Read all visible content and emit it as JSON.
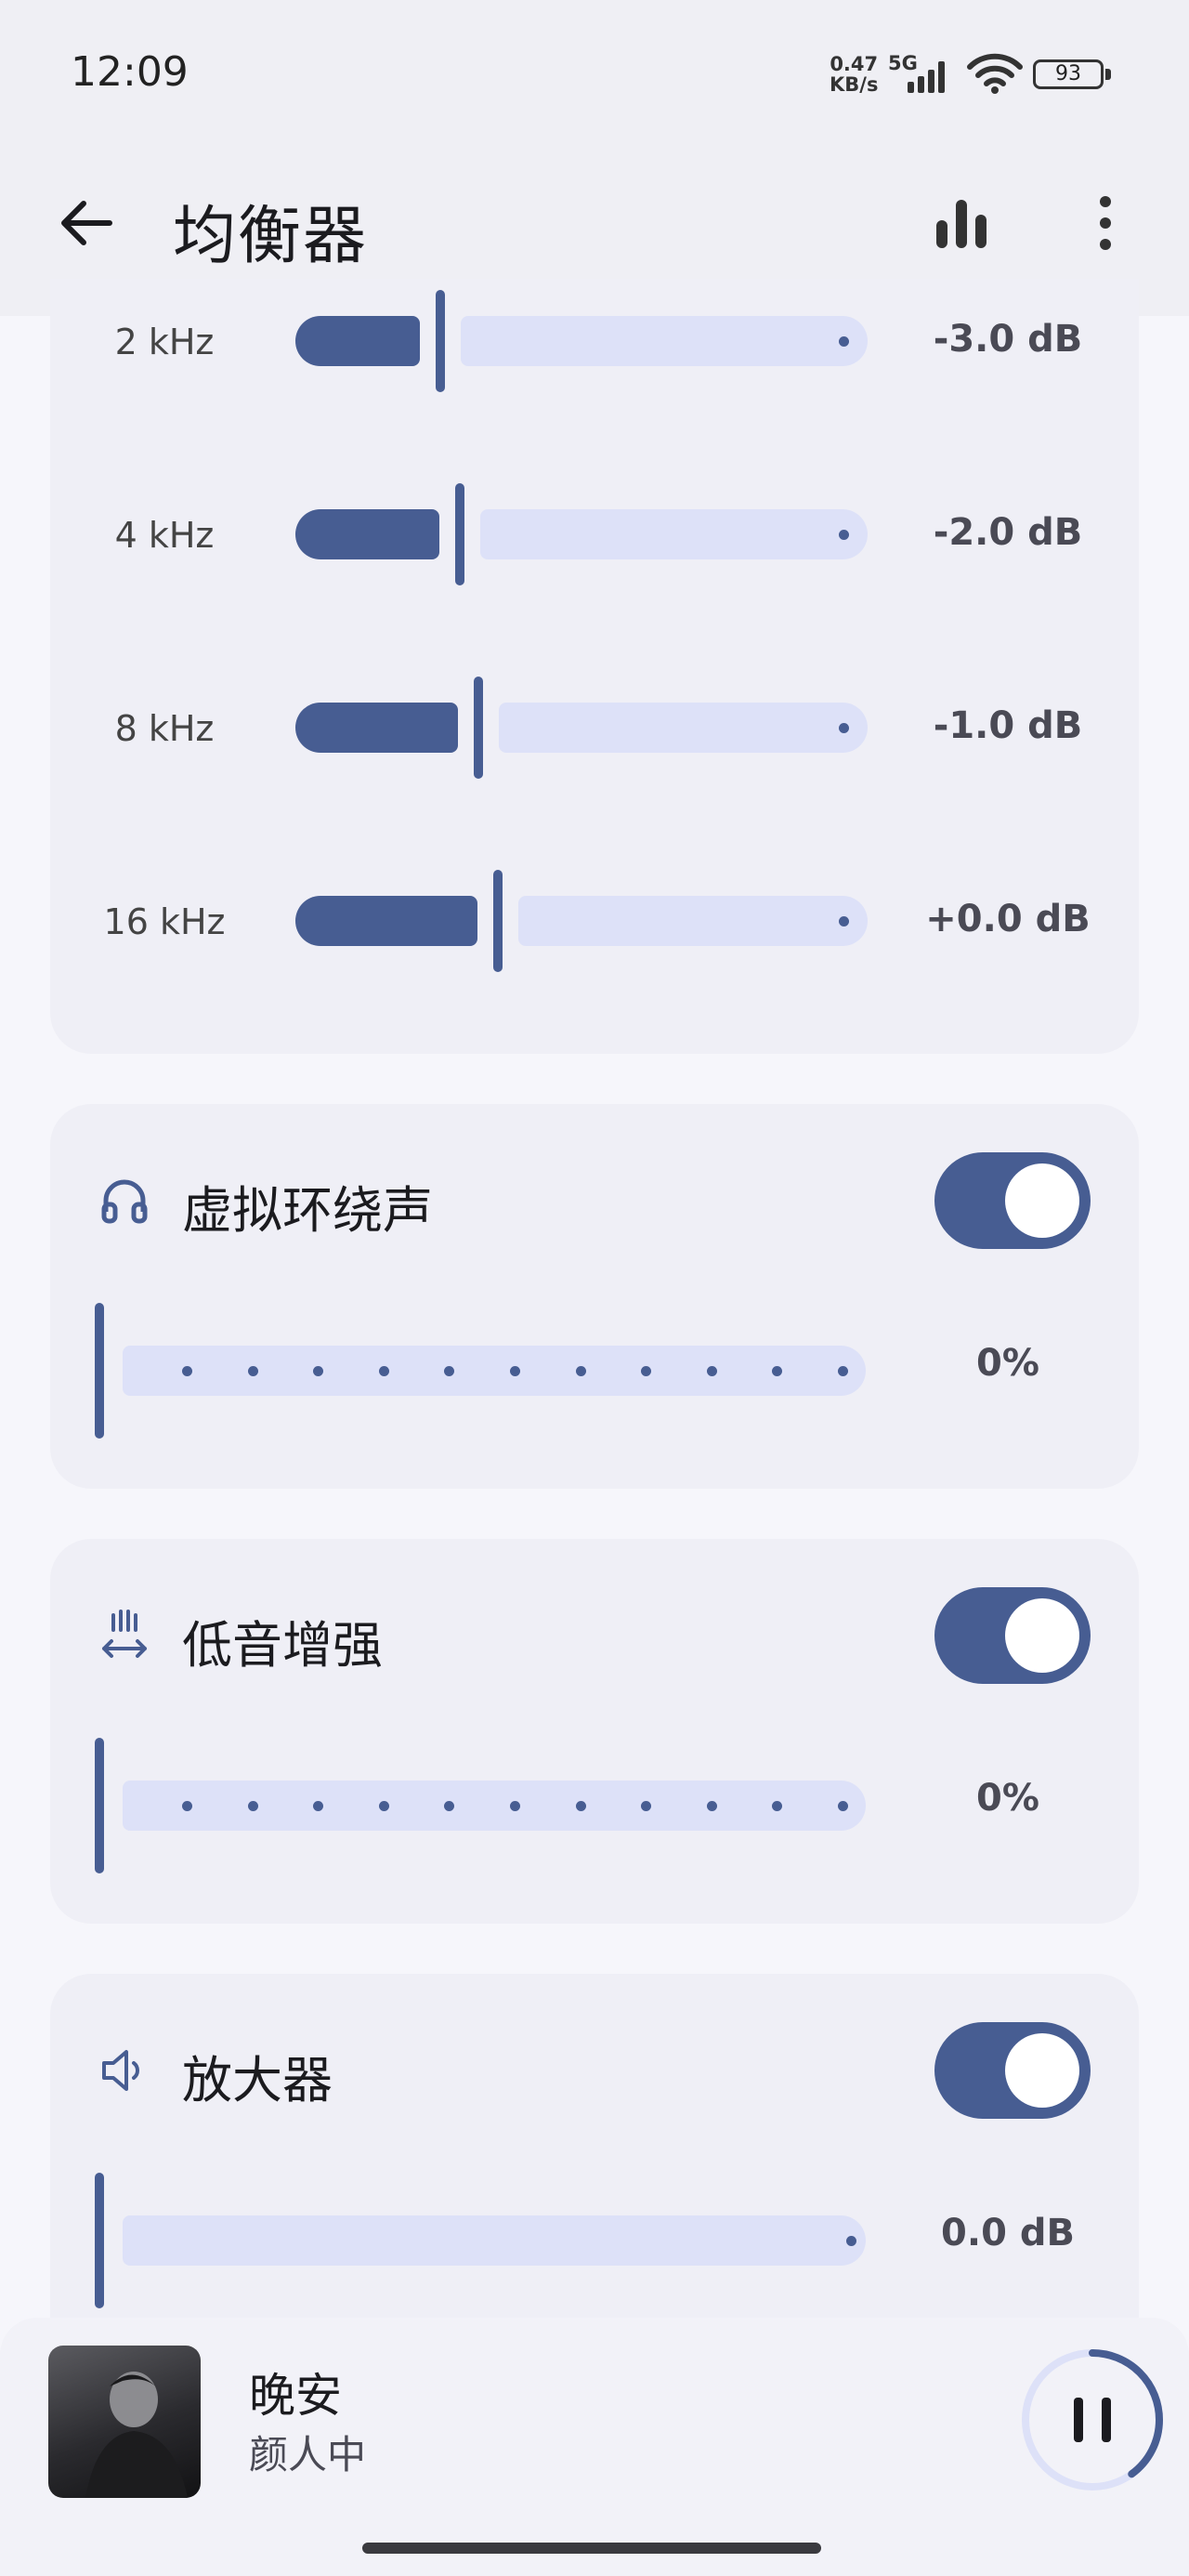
{
  "status_bar": {
    "time": "12:09",
    "net_speed_value": "0.47",
    "net_speed_unit": "KB/s",
    "network": "5G",
    "battery": "93"
  },
  "app_bar": {
    "title": "均衡器",
    "icons": [
      "back-arrow-icon",
      "bar-chart-icon",
      "more-vert-icon"
    ]
  },
  "equalizer": {
    "bands": [
      {
        "label": "2 kHz",
        "value": "-3.0 dB",
        "level": -3.0
      },
      {
        "label": "4 kHz",
        "value": "-2.0 dB",
        "level": -2.0
      },
      {
        "label": "8 kHz",
        "value": "-1.0 dB",
        "level": -1.0
      },
      {
        "label": "16 kHz",
        "value": "+0.0 dB",
        "level": 0.0
      }
    ]
  },
  "virtualizer": {
    "title": "虚拟环绕声",
    "icon": "headphones-icon",
    "enabled": true,
    "value": "0%"
  },
  "bass_boost": {
    "title": "低音增强",
    "icon": "bass-boost-icon",
    "enabled": true,
    "value": "0%"
  },
  "amplifier": {
    "title": "放大器",
    "icon": "speaker-icon",
    "enabled": true,
    "value": "0.0 dB"
  },
  "now_playing": {
    "song": "晚安",
    "artist": "颜人中",
    "progress": 0.4
  },
  "colors": {
    "accent": "#475D92",
    "track": "#DDE1F8",
    "card": "#EFEFF6",
    "background": "#F6F6FB"
  }
}
